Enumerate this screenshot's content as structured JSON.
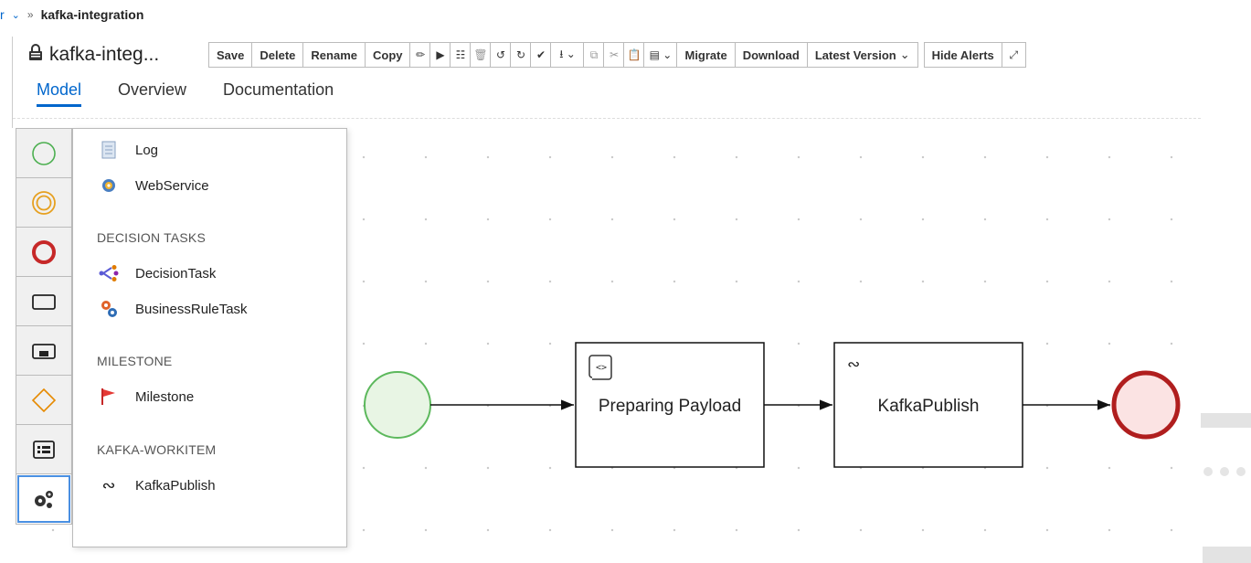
{
  "breadcrumb": {
    "parent": "r",
    "separator": "»",
    "current": "kafka-integration"
  },
  "title": "kafka-integ...",
  "toolbar": {
    "save": "Save",
    "delete": "Delete",
    "rename": "Rename",
    "copy": "Copy",
    "migrate": "Migrate",
    "download": "Download",
    "latest_version": "Latest Version",
    "hide_alerts": "Hide Alerts"
  },
  "tabs": [
    "Model",
    "Overview",
    "Documentation"
  ],
  "flyout": {
    "items_top": [
      "Log",
      "WebService"
    ],
    "section_decision": "DECISION TASKS",
    "items_decision": [
      "DecisionTask",
      "BusinessRuleTask"
    ],
    "section_milestone": "MILESTONE",
    "items_milestone": [
      "Milestone"
    ],
    "section_kafka": "KAFKA-WORKITEM",
    "items_kafka": [
      "KafkaPublish"
    ]
  },
  "diagram": {
    "task1_label": "Preparing Payload",
    "task2_label": "KafkaPublish"
  },
  "colors": {
    "accent": "#0066cc",
    "start_event_stroke": "#5cb85c",
    "start_event_fill": "#e8f5e4",
    "end_event_stroke": "#b01e1e",
    "end_event_fill": "#fbe3e3",
    "selected_outline": "#4a90e2"
  }
}
